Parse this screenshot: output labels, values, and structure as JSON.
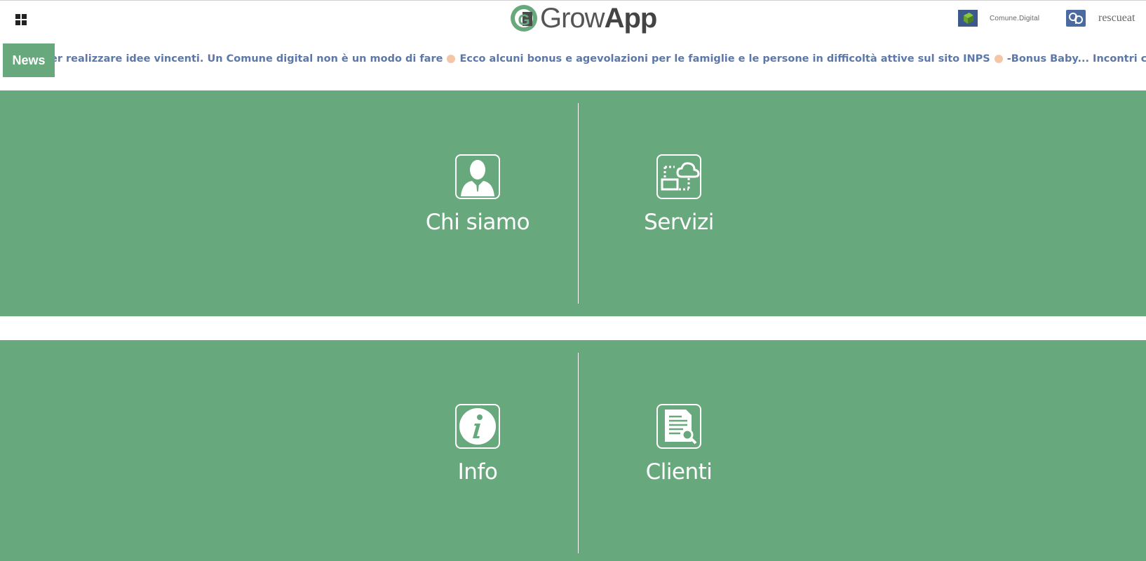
{
  "header": {
    "menu_icon": "grid-icon",
    "logo": {
      "text_light": "Grow",
      "text_bold": "App",
      "mark_letter": "G"
    },
    "partners": [
      {
        "name": "Comune.Digital",
        "icon": "cube-icon"
      },
      {
        "name": "rescueat",
        "icon": "rescueat-logo"
      }
    ]
  },
  "news": {
    "label": "News",
    "items": [
      "er realizzare idee vincenti. Un Comune digital non è un modo di fare",
      "Ecco alcuni bonus e agevolazioni per le famiglie e le persone in difficoltà attive sul sito INPS",
      "-Bonus Baby...",
      "Incontri con le scuole*Dopo il periodo di blocco forzato ricominciamo"
    ]
  },
  "colors": {
    "accent_green": "#68a87d",
    "ticker_text": "#5b78a8",
    "logo_text": "#555555"
  },
  "tiles": {
    "chi_siamo": {
      "label": "Chi siamo",
      "icon": "person-icon"
    },
    "servizi": {
      "label": "Servizi",
      "icon": "cloud-network-icon"
    },
    "info": {
      "label": "Info",
      "icon": "info-icon"
    },
    "clienti": {
      "label": "Clienti",
      "icon": "document-search-icon"
    }
  }
}
